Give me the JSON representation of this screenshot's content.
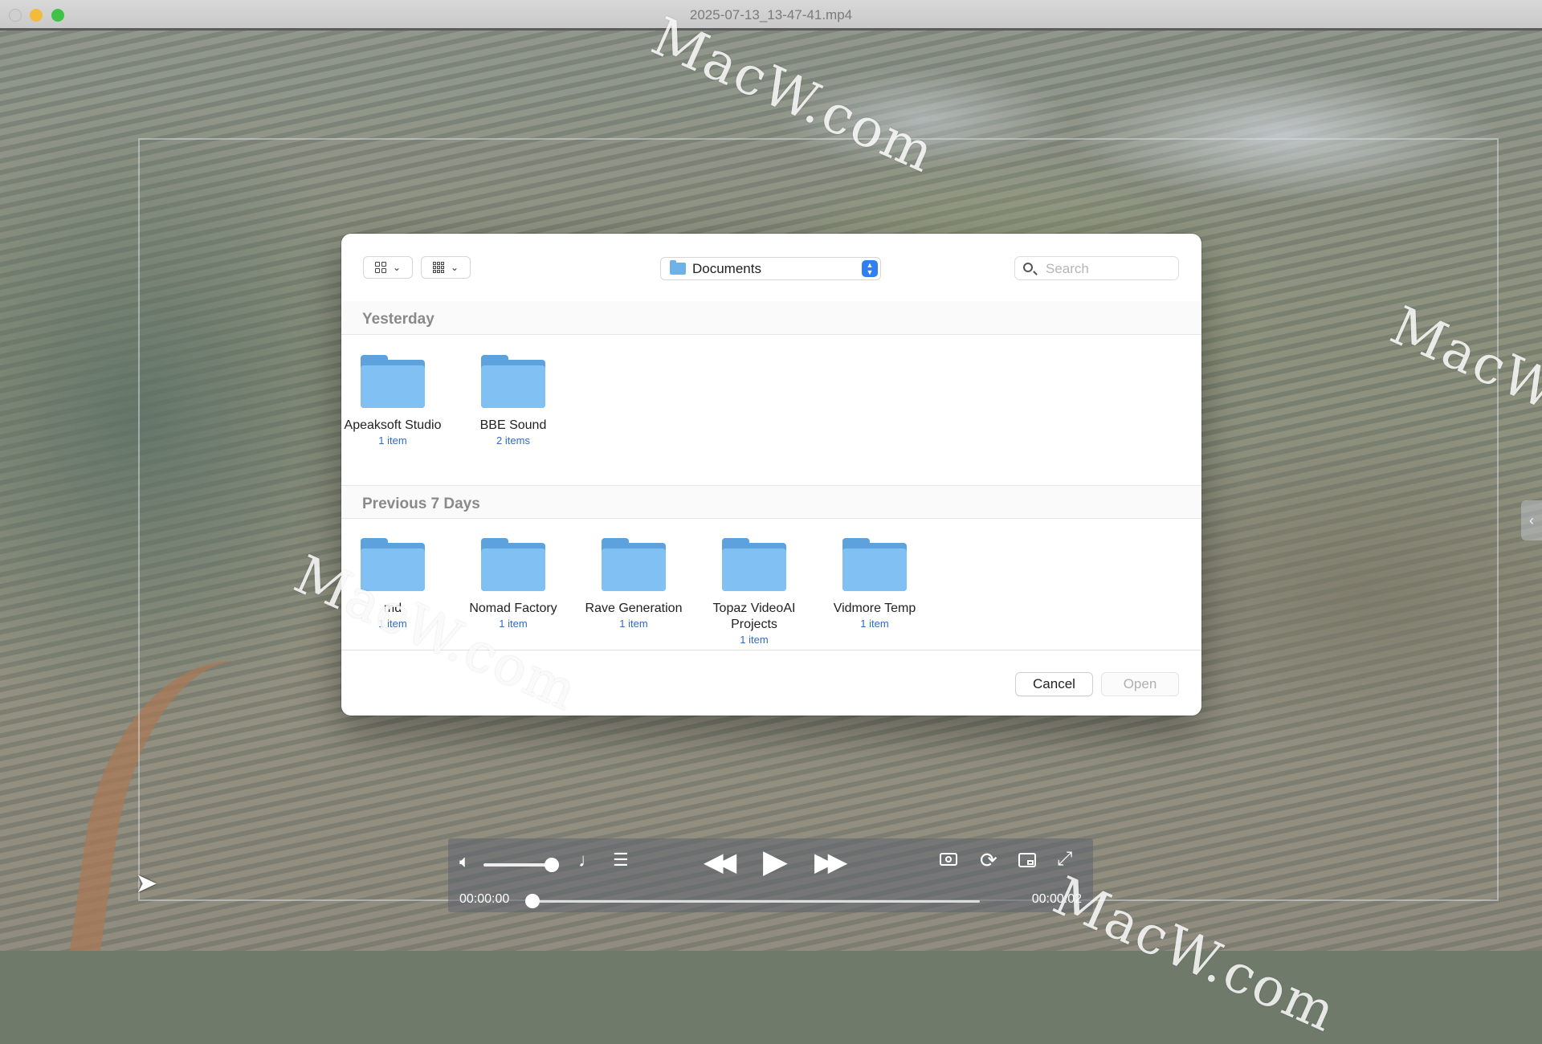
{
  "window": {
    "title": "2025-07-13_13-47-41.mp4"
  },
  "watermark": "MacW.com",
  "dialog": {
    "location": "Documents",
    "search": {
      "placeholder": "Search",
      "value": ""
    },
    "sections": [
      {
        "title": "Yesterday",
        "items": [
          {
            "name": "Apeaksoft Studio",
            "count": "1 item"
          },
          {
            "name": "BBE Sound",
            "count": "2 items"
          }
        ]
      },
      {
        "title": "Previous 7 Days",
        "items": [
          {
            "name": "md",
            "count": "1 item"
          },
          {
            "name": "Nomad Factory",
            "count": "1 item"
          },
          {
            "name": "Rave Generation",
            "count": "1 item"
          },
          {
            "name": "Topaz VideoAI Projects",
            "count": "1 item"
          },
          {
            "name": "Vidmore Temp",
            "count": "1 item"
          }
        ]
      }
    ],
    "buttons": {
      "cancel": "Cancel",
      "open": "Open"
    }
  },
  "player": {
    "current_time": "00:00:00",
    "duration": "00:00:02",
    "volume_level": 0.9,
    "progress": 0
  },
  "colors": {
    "accent": "#2f7ff3",
    "folder": "#80c0f2",
    "item_count": "#2f6bbf"
  }
}
